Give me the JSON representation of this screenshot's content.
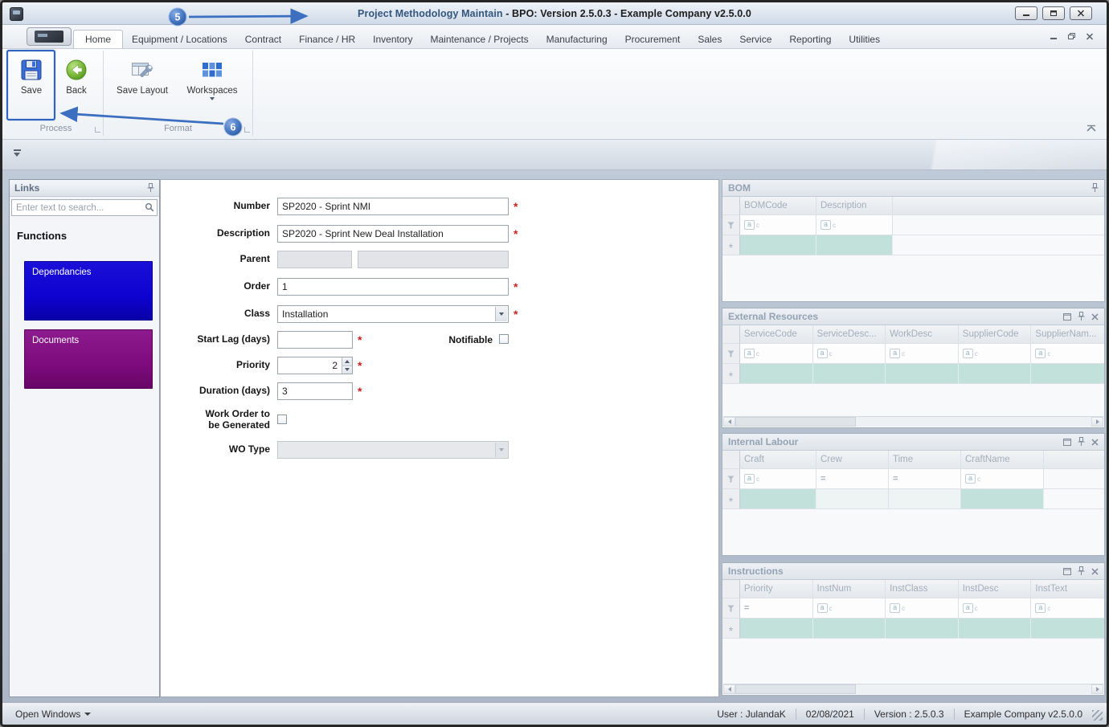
{
  "window": {
    "title_primary": "Project Methodology Maintain",
    "title_secondary": " - BPO: Version 2.5.0.3 - Example Company v2.5.0.0"
  },
  "callouts": {
    "step5": "5",
    "step6": "6"
  },
  "colors": {
    "callout_accent": "#3c6fc0",
    "dependancies_button": "#0d02cf",
    "documents_button": "#7d0b7d",
    "new_row_teal": "#c3e1db",
    "required_marker": "#cc2222"
  },
  "ribbon": {
    "tabs": [
      "Home",
      "Equipment / Locations",
      "Contract",
      "Finance / HR",
      "Inventory",
      "Maintenance / Projects",
      "Manufacturing",
      "Procurement",
      "Sales",
      "Service",
      "Reporting",
      "Utilities"
    ],
    "active_tab": "Home",
    "save_label": "Save",
    "back_label": "Back",
    "save_layout_label": "Save Layout",
    "workspaces_label": "Workspaces",
    "process_group_label": "Process",
    "format_group_label": "Format"
  },
  "links_panel": {
    "title": "Links",
    "search_placeholder": "Enter text to search...",
    "heading": "Functions",
    "buttons": [
      {
        "label": "Dependancies"
      },
      {
        "label": "Documents"
      }
    ]
  },
  "form": {
    "required_marker": "*",
    "number_label": "Number",
    "number_value": "SP2020 - Sprint NMI",
    "description_label": "Description",
    "description_value": "SP2020 - Sprint New Deal Installation",
    "parent_label": "Parent",
    "order_label": "Order",
    "order_value": "1",
    "class_label": "Class",
    "class_value": "Installation",
    "start_lag_label": "Start Lag (days)",
    "start_lag_value": "",
    "notifiable_label": "Notifiable",
    "notifiable_checked": false,
    "priority_label": "Priority",
    "priority_value": "2",
    "duration_label": "Duration (days)",
    "duration_value": "3",
    "wo_generated_label": "Work Order to be Generated",
    "wo_generated_checked": false,
    "wo_type_label": "WO Type",
    "wo_type_value": ""
  },
  "panels": [
    {
      "title": "BOM",
      "columns": [
        "BOMCode",
        "Description"
      ]
    },
    {
      "title": "External Resources",
      "columns": [
        "ServiceCode",
        "ServiceDesc...",
        "WorkDesc",
        "SupplierCode",
        "SupplierNam..."
      ]
    },
    {
      "title": "Internal Labour",
      "columns": [
        "Craft",
        "Crew",
        "Time",
        "CraftName"
      ]
    },
    {
      "title": "Instructions",
      "columns": [
        "Priority",
        "InstNum",
        "InstClass",
        "InstDesc",
        "InstText"
      ]
    }
  ],
  "ui": {
    "filter_equals": "=",
    "new_row_glyph": "*"
  },
  "statusbar": {
    "open_windows": "Open Windows",
    "user": "User : JulandaK",
    "date": "02/08/2021",
    "version": "Version : 2.5.0.3",
    "company": "Example Company v2.5.0.0"
  }
}
